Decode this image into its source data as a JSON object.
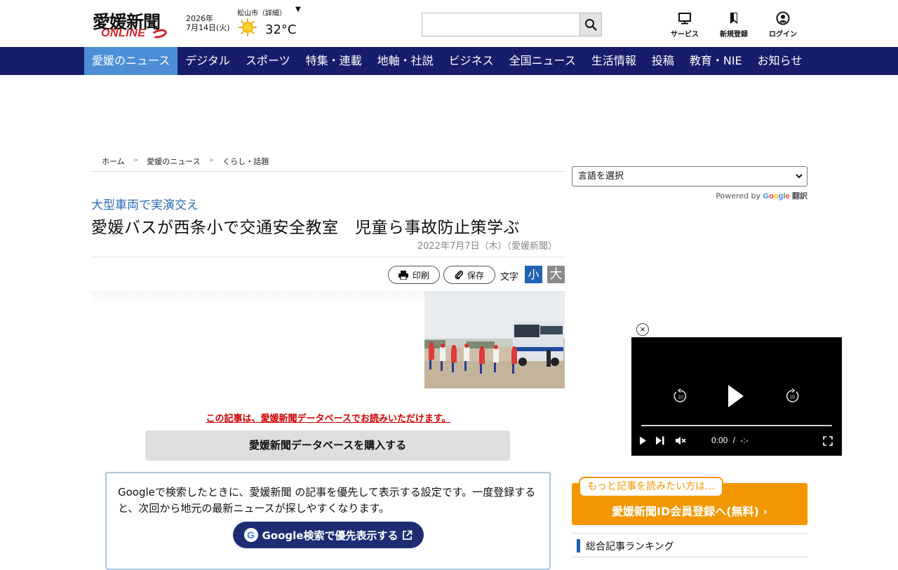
{
  "header": {
    "logo_top": "愛媛新聞",
    "logo_bottom": "ONLINE",
    "date_year": "2026年",
    "date_day": "7月14日(火)",
    "weather_city": "松山市（詳細）",
    "weather_caret": "▼",
    "weather_icon": "sun-icon",
    "temperature": "32°C",
    "search_placeholder": "",
    "icons": [
      {
        "name": "service-icon",
        "label": "サービス"
      },
      {
        "name": "register-icon",
        "label": "新規登録"
      },
      {
        "name": "login-icon",
        "label": "ログイン"
      }
    ]
  },
  "nav": {
    "items": [
      "愛媛のニュース",
      "デジタル",
      "スポーツ",
      "特集・連載",
      "地軸・社説",
      "ビジネス",
      "全国ニュース",
      "生活情報",
      "投稿",
      "教育・NIE",
      "お知らせ"
    ],
    "active_index": 0
  },
  "breadcrumb": {
    "items": [
      "ホーム",
      "愛媛のニュース",
      "くらし・話題"
    ],
    "separator": ">"
  },
  "article": {
    "subtitle": "大型車両で実演交え",
    "title": "愛媛バスが西条小で交通安全教室　児童ら事故防止策学ぶ",
    "published": "2022年7月7日（木）（愛媛新聞）",
    "print_label": "印刷",
    "save_label": "保存",
    "font_size_label": "文字",
    "font_small": "小",
    "font_large": "大",
    "db_note": "この記事は、愛媛新聞データベースでお読みいただけます。",
    "db_button": "愛媛新聞データベースを購入する",
    "google_text": "Googleで検索したときに、愛媛新聞 の記事を優先して表示する設定です。一度登録すると、次回から地元の最新ニュースが探しやすくなります。",
    "google_button": "Google検索で優先表示する",
    "google_letter": "G"
  },
  "sidebar": {
    "language_select": "言語を選択",
    "powered_by": "Powered by",
    "google_word": [
      "G",
      "o",
      "o",
      "g",
      "l",
      "e"
    ],
    "translate_label": "翻訳",
    "video": {
      "close": "×",
      "time_current": "0:00",
      "time_separator": "/",
      "time_total": "-:-",
      "skip_back": "10",
      "skip_forward": "10"
    },
    "member_bubble": "もっと記事を読みたい方は…",
    "member_button": "愛媛新聞ID会員登録へ(無料) ›",
    "ranking_title": "総合記事ランキング"
  },
  "colors": {
    "nav_bg": "#171d6a",
    "nav_active": "#4d8fd6",
    "subtitle": "#2b6bb3",
    "db_note": "#d30000",
    "member_orange": "#f39700",
    "google_button": "#1e2c74"
  }
}
